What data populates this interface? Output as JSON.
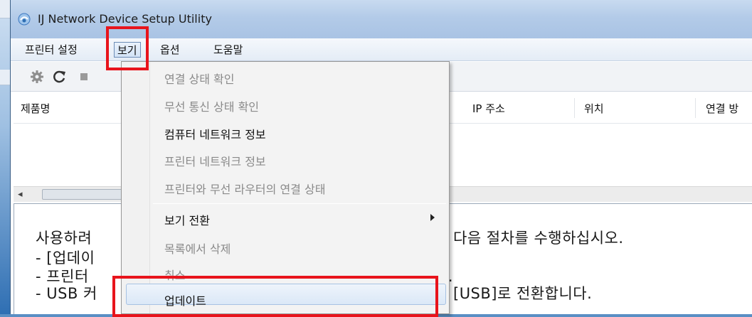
{
  "window": {
    "title": "IJ Network Device Setup Utility"
  },
  "menubar": {
    "items": [
      {
        "label": "프린터 설정"
      },
      {
        "label": "보기"
      },
      {
        "label": "옵션"
      },
      {
        "label": "도움말"
      }
    ]
  },
  "toolbar": {
    "icons": [
      "gear-icon",
      "refresh-icon",
      "stop-icon"
    ]
  },
  "list": {
    "columns": [
      {
        "label": "제품명"
      },
      {
        "label": "IP 주소"
      },
      {
        "label": "위치"
      },
      {
        "label": "연결 방"
      }
    ]
  },
  "view_menu": {
    "items": [
      {
        "label": "연결 상태 확인",
        "enabled": false
      },
      {
        "label": "무선 통신 상태 확인",
        "enabled": false
      },
      {
        "label": "컴퓨터 네트워크 정보",
        "enabled": true
      },
      {
        "label": "프린터 네트워크 정보",
        "enabled": false
      },
      {
        "label": "프린터와 무선 라우터의 연결 상태",
        "enabled": false
      },
      {
        "label": "보기 전환",
        "enabled": true,
        "submenu": true
      },
      {
        "label": "목록에서 삭제",
        "enabled": false
      },
      {
        "label": "취소",
        "enabled": false
      },
      {
        "label": "업데이트",
        "enabled": true,
        "highlighted": true
      }
    ]
  },
  "info": {
    "lines": [
      {
        "left": "사용하려",
        "right": "우 다음 절차를 수행하십시오."
      },
      {
        "left": "- [업데이",
        "right": ""
      },
      {
        "left": "- 프린터",
        "right": "다."
      },
      {
        "left": "- USB 커",
        "right": "를 [USB]로 전환합니다."
      },
      {
        "left": "",
        "right": ""
      }
    ]
  },
  "colors": {
    "highlight": "#e8141c",
    "title_bg": "#b3cbe8"
  }
}
